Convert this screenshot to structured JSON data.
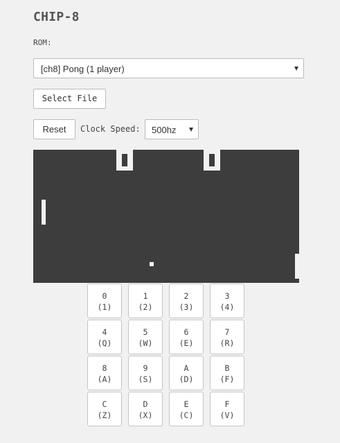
{
  "app": {
    "title": "CHIP-8"
  },
  "rom": {
    "label": "ROM:",
    "selected": "[ch8] Pong (1 player)"
  },
  "controls": {
    "select_file_label": "Select File",
    "reset_label": "Reset",
    "clock_label": "Clock Speed:",
    "clock_selected": "500hz"
  },
  "colors": {
    "page_background": "#f1f1f1",
    "screen_background": "#3d3d3d",
    "pixel_on": "#f2f2f2"
  },
  "keypad": [
    {
      "hex": "0",
      "key": "(1)"
    },
    {
      "hex": "1",
      "key": "(2)"
    },
    {
      "hex": "2",
      "key": "(3)"
    },
    {
      "hex": "3",
      "key": "(4)"
    },
    {
      "hex": "4",
      "key": "(Q)"
    },
    {
      "hex": "5",
      "key": "(W)"
    },
    {
      "hex": "6",
      "key": "(E)"
    },
    {
      "hex": "7",
      "key": "(R)"
    },
    {
      "hex": "8",
      "key": "(A)"
    },
    {
      "hex": "9",
      "key": "(S)"
    },
    {
      "hex": "A",
      "key": "(D)"
    },
    {
      "hex": "B",
      "key": "(F)"
    },
    {
      "hex": "C",
      "key": "(Z)"
    },
    {
      "hex": "D",
      "key": "(X)"
    },
    {
      "hex": "E",
      "key": "(C)"
    },
    {
      "hex": "F",
      "key": "(V)"
    }
  ]
}
